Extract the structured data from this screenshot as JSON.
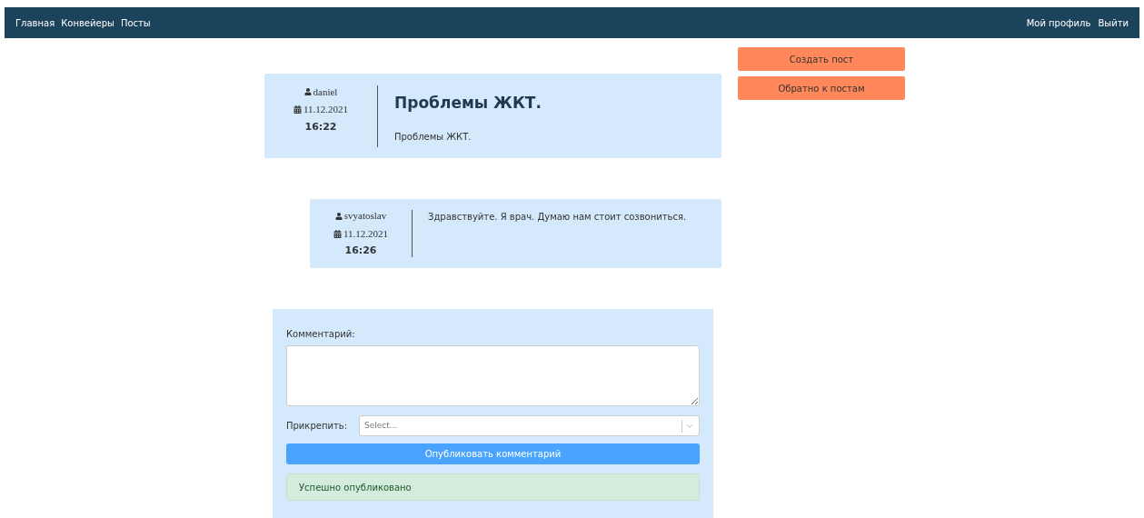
{
  "nav": {
    "left": [
      "Главная",
      "Конвейеры",
      "Посты"
    ],
    "right": [
      "Мой профиль",
      "Выйти"
    ]
  },
  "actions": [
    "Создать пост",
    "Обратно к постам"
  ],
  "post": {
    "author": "daniel",
    "date": "11.12.2021",
    "time": "16:22",
    "title": "Проблемы ЖКТ.",
    "body": "Проблемы ЖКТ."
  },
  "comments": [
    {
      "author": "svyatoslav",
      "date": "11.12.2021",
      "time": "16:26",
      "text": "Здравствуйте. Я врач. Думаю нам стоит созвониться."
    }
  ],
  "form": {
    "comment_label": "Комментарий:",
    "attach_label": "Прикрепить:",
    "attach_placeholder": "Select...",
    "submit": "Опубликовать комментарий",
    "alert": "Успешно опубликовано"
  }
}
